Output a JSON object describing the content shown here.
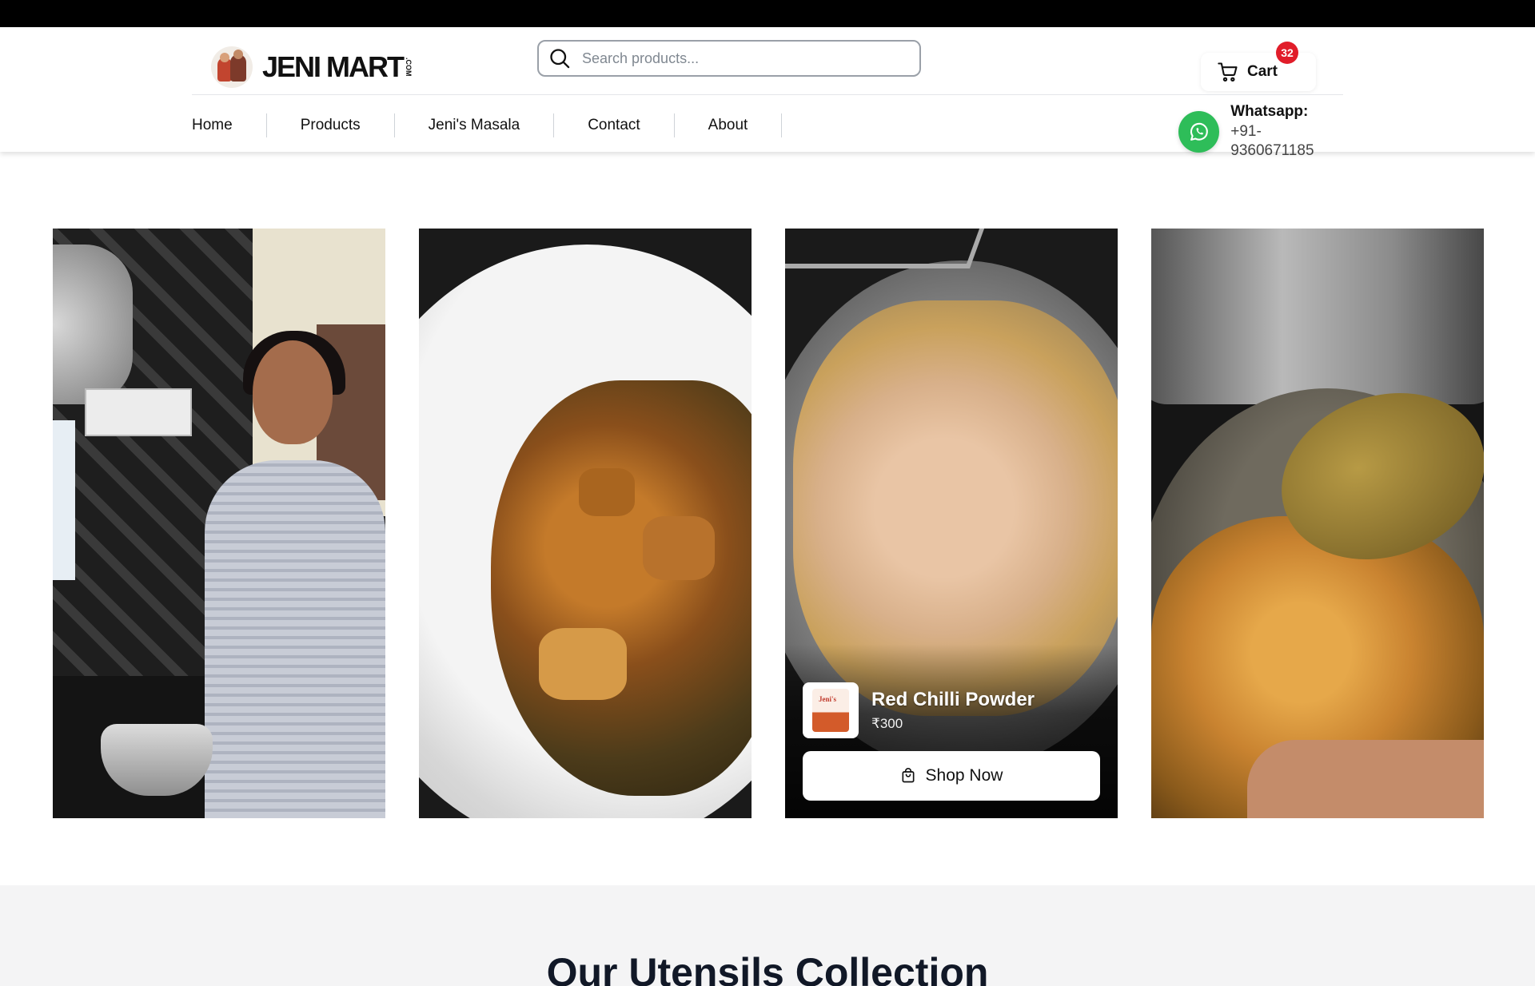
{
  "brand": {
    "name": "JENI MART",
    "suffix": ".COM"
  },
  "search": {
    "placeholder": "Search products..."
  },
  "cart": {
    "label": "Cart",
    "count": "32"
  },
  "nav": {
    "items": [
      "Home",
      "Products",
      "Jeni's Masala",
      "Contact",
      "About"
    ]
  },
  "whatsapp": {
    "title": "Whatsapp:",
    "number": "+91-9360671185"
  },
  "featured_product": {
    "name": "Red Chilli Powder",
    "price": "₹300",
    "button_label": "Shop Now",
    "thumb_label": "Jeni's"
  },
  "sections": {
    "utensils_title": "Our Utensils Collection"
  },
  "colors": {
    "badge": "#e11d2a",
    "whatsapp": "#2ebd59",
    "heading": "#111827"
  },
  "icons": {
    "search": "search-icon",
    "cart": "cart-icon",
    "whatsapp": "whatsapp-icon",
    "bag": "shopping-bag-icon"
  }
}
